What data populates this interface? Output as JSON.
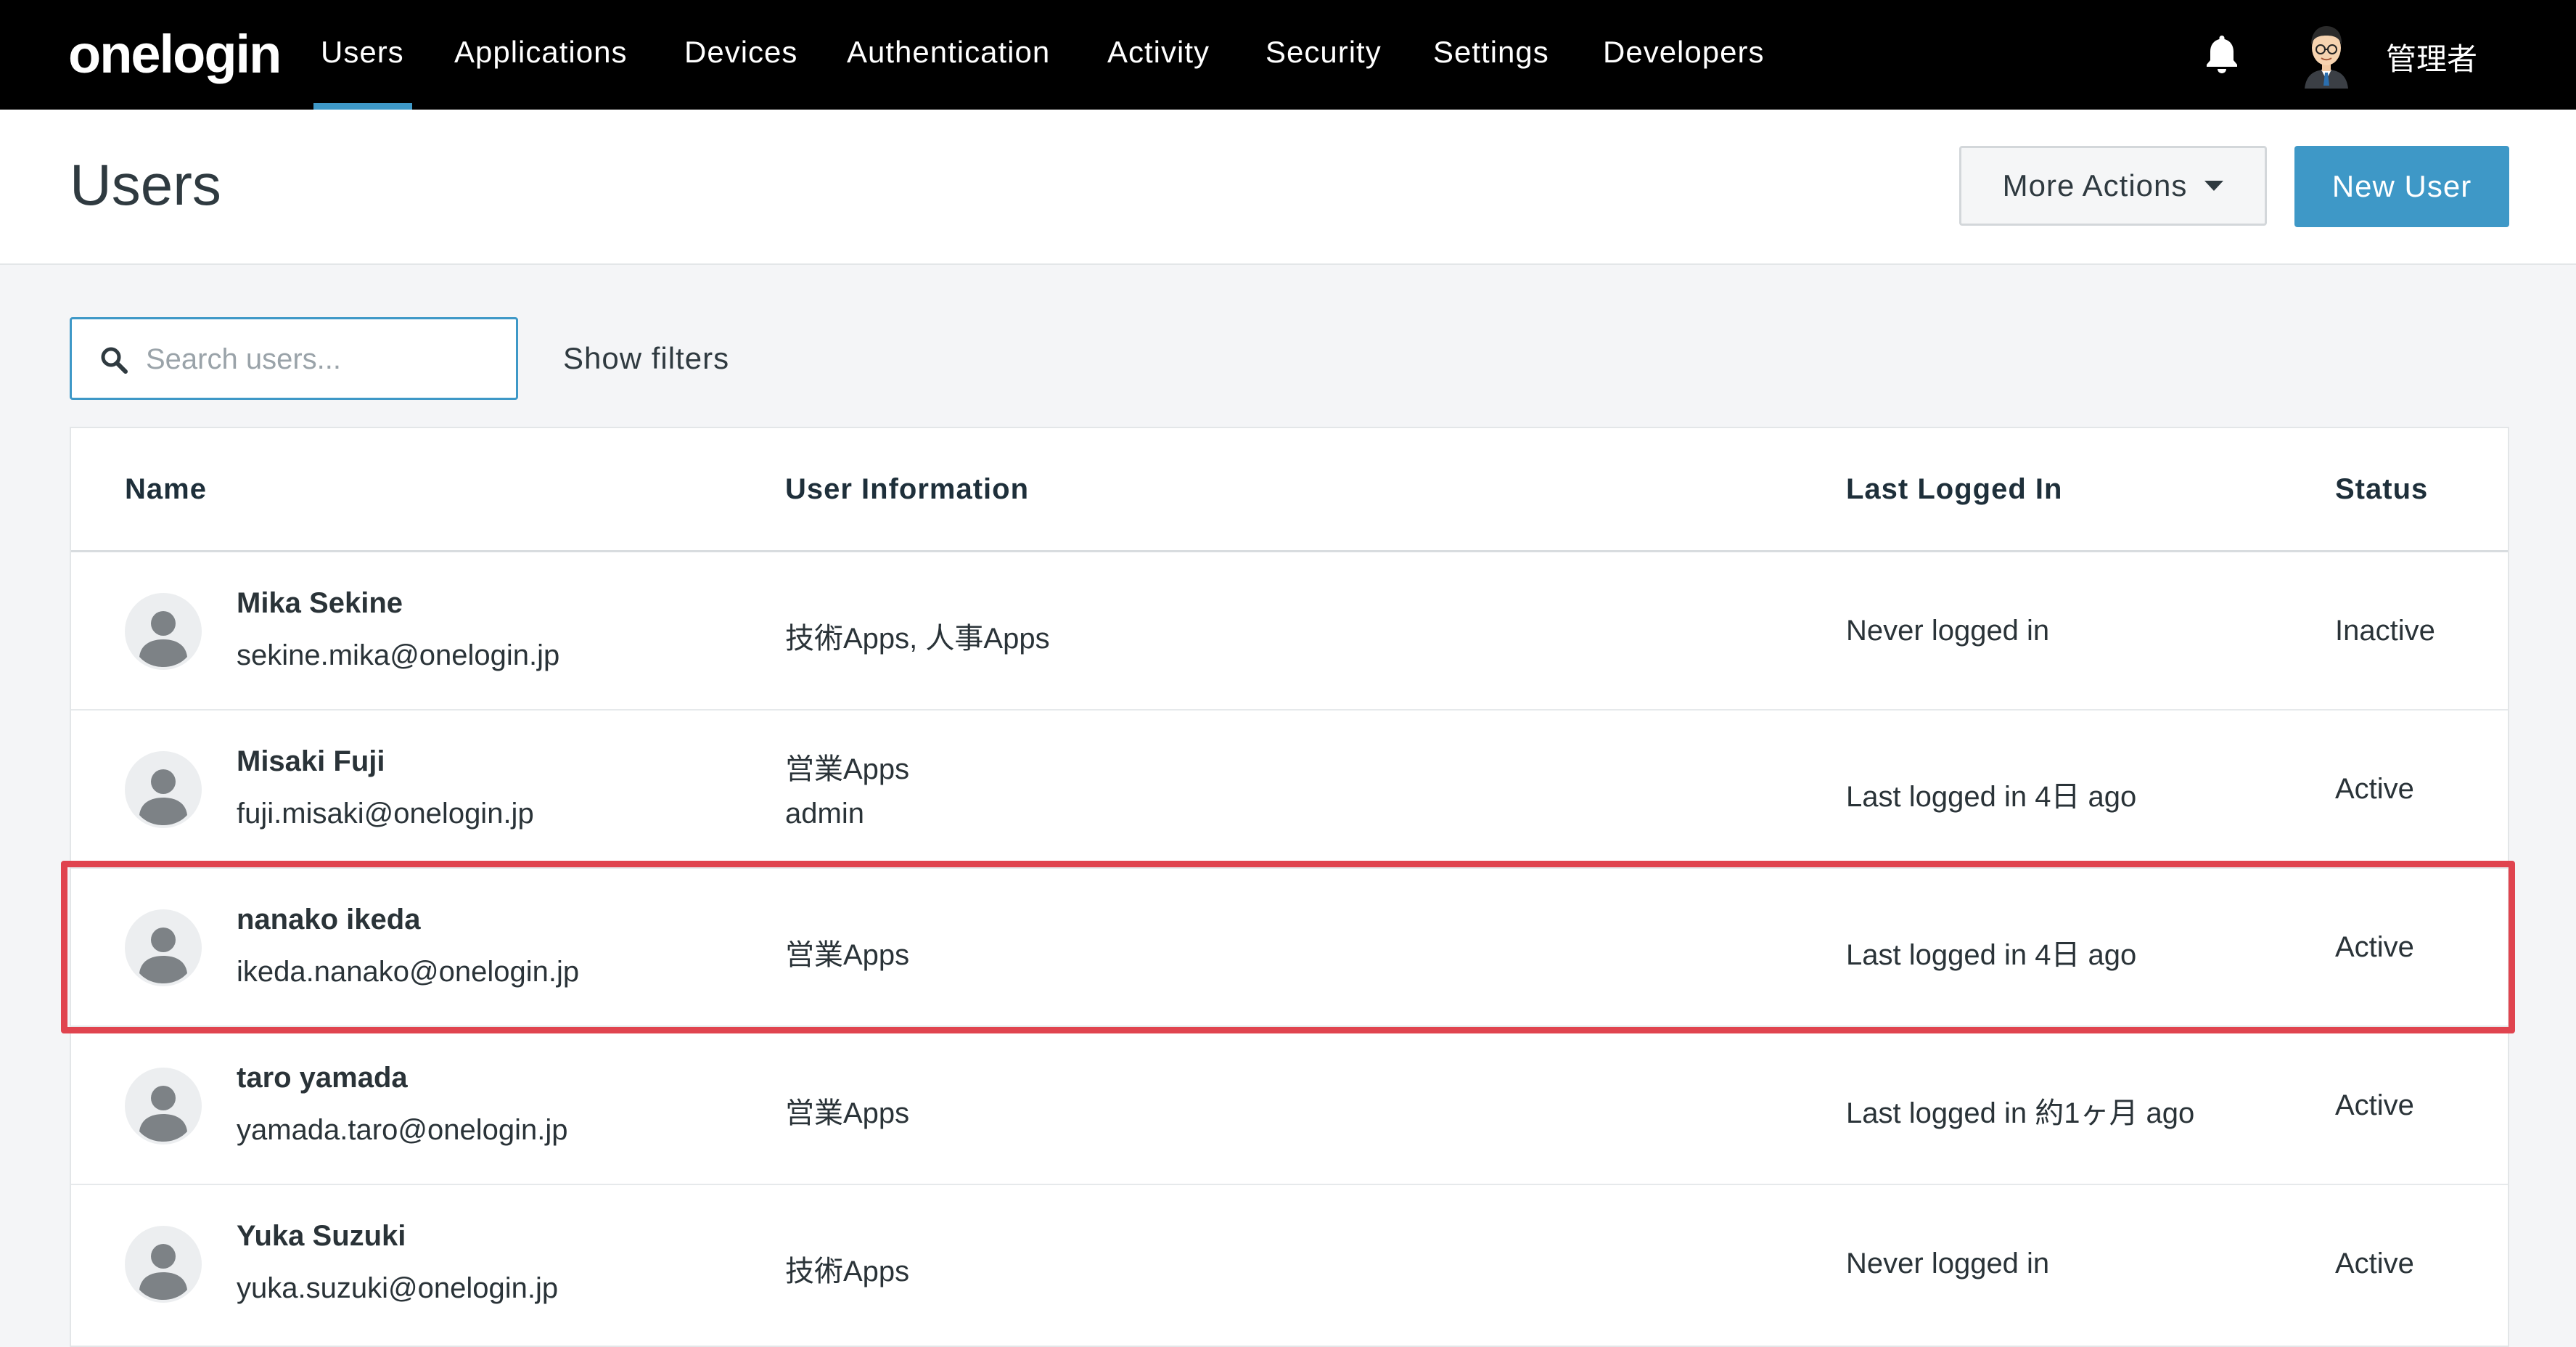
{
  "brand": {
    "logo_text": "onelogin"
  },
  "nav": {
    "items": [
      {
        "label": "Users"
      },
      {
        "label": "Applications"
      },
      {
        "label": "Devices"
      },
      {
        "label": "Authentication"
      },
      {
        "label": "Activity"
      },
      {
        "label": "Security"
      },
      {
        "label": "Settings"
      },
      {
        "label": "Developers"
      }
    ],
    "active": "Users",
    "notification_icon": "bell-icon",
    "admin_name": "管理者"
  },
  "header": {
    "title": "Users",
    "more_actions_label": "More Actions",
    "new_user_label": "New User"
  },
  "search": {
    "placeholder": "Search users...",
    "value": "",
    "show_filters_label": "Show filters"
  },
  "table": {
    "columns": [
      "Name",
      "User Information",
      "Last Logged In",
      "Status"
    ],
    "rows": [
      {
        "name": "Mika Sekine",
        "email": "sekine.mika@onelogin.jp",
        "info": [
          "技術Apps, 人事Apps"
        ],
        "last_logged_in": "Never logged in",
        "status": "Inactive"
      },
      {
        "name": "Misaki Fuji",
        "email": "fuji.misaki@onelogin.jp",
        "info": [
          "営業Apps",
          "admin"
        ],
        "last_logged_in": "Last logged in 4日 ago",
        "status": "Active"
      },
      {
        "name": "nanako ikeda",
        "email": "ikeda.nanako@onelogin.jp",
        "info": [
          "営業Apps"
        ],
        "last_logged_in": "Last logged in 4日 ago",
        "status": "Active"
      },
      {
        "name": "taro yamada",
        "email": "yamada.taro@onelogin.jp",
        "info": [
          "営業Apps"
        ],
        "last_logged_in": "Last logged in 約1ヶ月 ago",
        "status": "Active"
      },
      {
        "name": "Yuka Suzuki",
        "email": "yuka.suzuki@onelogin.jp",
        "info": [
          "技術Apps"
        ],
        "last_logged_in": "Never logged in",
        "status": "Active"
      }
    ],
    "highlighted_row": "nanako ikeda"
  },
  "colors": {
    "nav_bg": "#000000",
    "accent": "#3e98c7",
    "highlight": "#e0444f"
  }
}
